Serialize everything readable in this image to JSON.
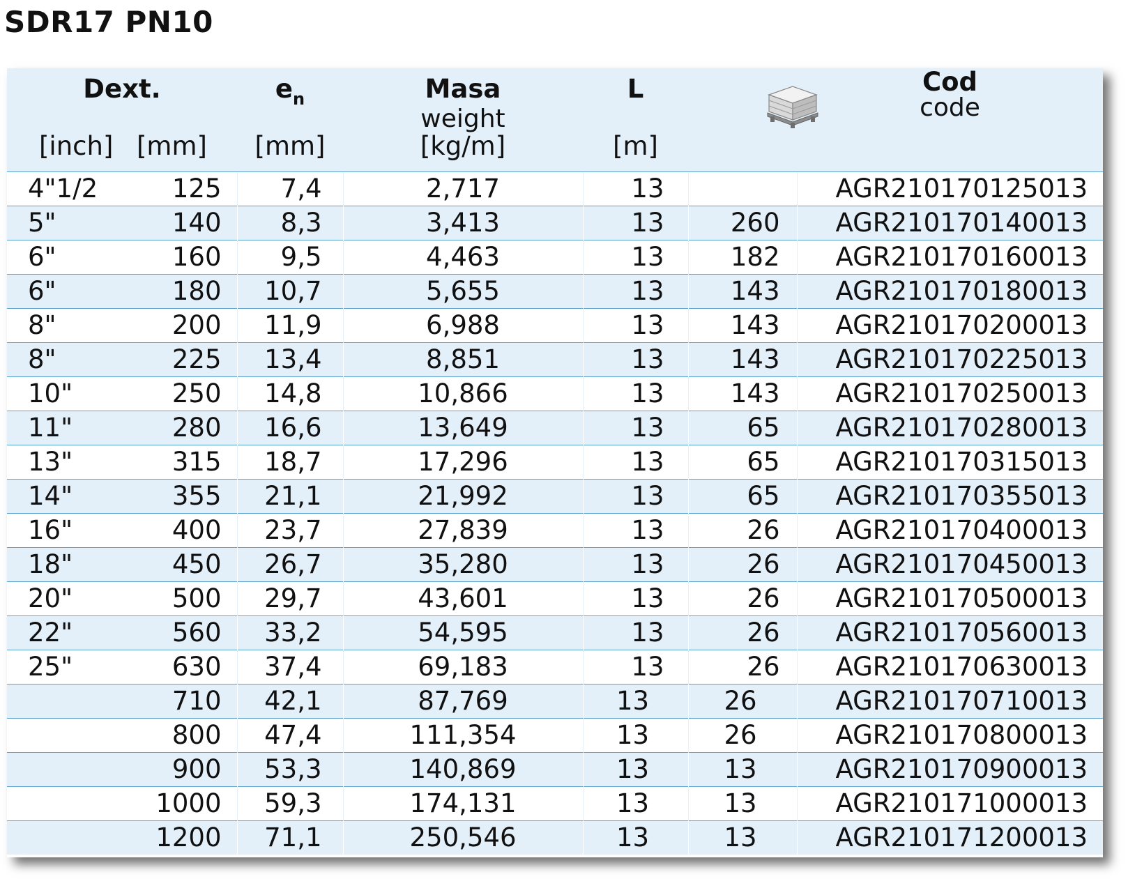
{
  "title": "SDR17 PN10",
  "header": {
    "dext": "Dext.",
    "inch_unit": "[inch]",
    "mm_unit": "[mm]",
    "en_main": "e",
    "en_sub": "n",
    "en_unit": "[mm]",
    "masa": "Masa",
    "weight": "weight",
    "masa_unit": "[kg/m]",
    "l": "L",
    "l_unit": "[m]",
    "pallet_icon": "pallet-boxes-icon",
    "cod": "Cod",
    "code": "code"
  },
  "rows": [
    {
      "inch": "4\"1/2",
      "mm": "125",
      "en": "7,4",
      "masa": "2,717",
      "l": "13",
      "qty": "",
      "code": "AGR210170125013"
    },
    {
      "inch": "5\"",
      "mm": "140",
      "en": "8,3",
      "masa": "3,413",
      "l": "13",
      "qty": "260",
      "code": "AGR210170140013"
    },
    {
      "inch": "6\"",
      "mm": "160",
      "en": "9,5",
      "masa": "4,463",
      "l": "13",
      "qty": "182",
      "code": "AGR210170160013"
    },
    {
      "inch": "6\"",
      "mm": "180",
      "en": "10,7",
      "masa": "5,655",
      "l": "13",
      "qty": "143",
      "code": "AGR210170180013"
    },
    {
      "inch": "8\"",
      "mm": "200",
      "en": "11,9",
      "masa": "6,988",
      "l": "13",
      "qty": "143",
      "code": "AGR210170200013"
    },
    {
      "inch": "8\"",
      "mm": "225",
      "en": "13,4",
      "masa": "8,851",
      "l": "13",
      "qty": "143",
      "code": "AGR210170225013"
    },
    {
      "inch": "10\"",
      "mm": "250",
      "en": "14,8",
      "masa": "10,866",
      "l": "13",
      "qty": "143",
      "code": "AGR210170250013"
    },
    {
      "inch": "11\"",
      "mm": "280",
      "en": "16,6",
      "masa": "13,649",
      "l": "13",
      "qty": "65",
      "code": "AGR210170280013"
    },
    {
      "inch": "13\"",
      "mm": "315",
      "en": "18,7",
      "masa": "17,296",
      "l": "13",
      "qty": "65",
      "code": "AGR210170315013"
    },
    {
      "inch": "14\"",
      "mm": "355",
      "en": "21,1",
      "masa": "21,992",
      "l": "13",
      "qty": "65",
      "code": "AGR210170355013"
    },
    {
      "inch": "16\"",
      "mm": "400",
      "en": "23,7",
      "masa": "27,839",
      "l": "13",
      "qty": "26",
      "code": "AGR210170400013"
    },
    {
      "inch": "18\"",
      "mm": "450",
      "en": "26,7",
      "masa": "35,280",
      "l": "13",
      "qty": "26",
      "code": "AGR210170450013"
    },
    {
      "inch": "20\"",
      "mm": "500",
      "en": "29,7",
      "masa": "43,601",
      "l": "13",
      "qty": "26",
      "code": "AGR210170500013"
    },
    {
      "inch": "22\"",
      "mm": "560",
      "en": "33,2",
      "masa": "54,595",
      "l": "13",
      "qty": "26",
      "code": "AGR210170560013"
    },
    {
      "inch": "25\"",
      "mm": "630",
      "en": "37,4",
      "masa": "69,183",
      "l": "13",
      "qty": "26",
      "code": "AGR210170630013"
    },
    {
      "inch": "",
      "mm": "710",
      "en": "42,1",
      "masa": "87,769",
      "l": "13",
      "qty": "26",
      "code": "AGR210170710013"
    },
    {
      "inch": "",
      "mm": "800",
      "en": "47,4",
      "masa": "111,354",
      "l": "13",
      "qty": "26",
      "code": "AGR210170800013"
    },
    {
      "inch": "",
      "mm": "900",
      "en": "53,3",
      "masa": "140,869",
      "l": "13",
      "qty": "13",
      "code": "AGR210170900013"
    },
    {
      "inch": "",
      "mm": "1000",
      "en": "59,3",
      "masa": "174,131",
      "l": "13",
      "qty": "13",
      "code": "AGR210171000013"
    },
    {
      "inch": "",
      "mm": "1200",
      "en": "71,1",
      "masa": "250,546",
      "l": "13",
      "qty": "13",
      "code": "AGR210171200013"
    }
  ]
}
